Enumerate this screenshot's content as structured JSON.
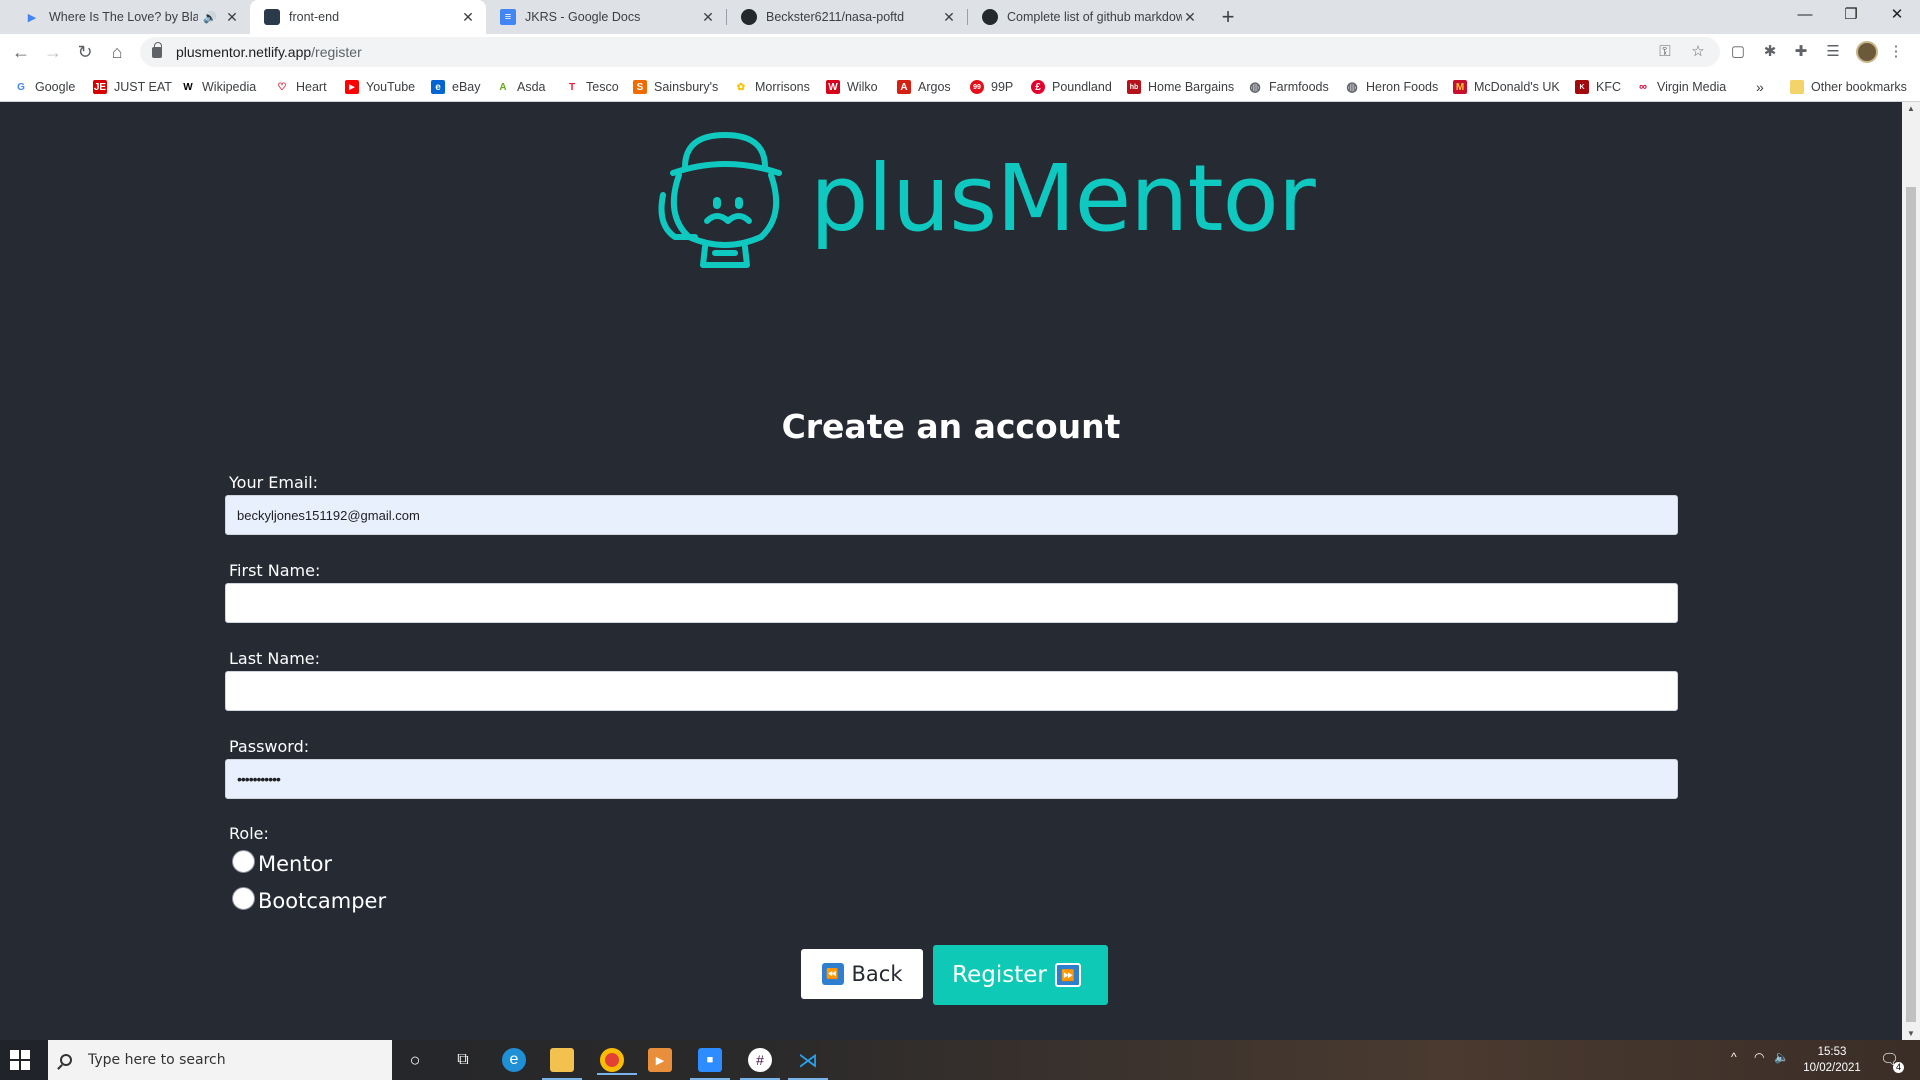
{
  "browser": {
    "tabs": [
      {
        "title": "Where Is The Love? by Black",
        "icon": "play-icon",
        "audio": true
      },
      {
        "title": "front-end",
        "icon": "netlify-icon",
        "active": true
      },
      {
        "title": "JKRS - Google Docs",
        "icon": "docs-icon"
      },
      {
        "title": "Beckster6211/nasa-poftd",
        "icon": "github-icon"
      },
      {
        "title": "Complete list of github markdow",
        "icon": "github-icon"
      }
    ],
    "url": {
      "host": "plusmentor.netlify.app",
      "path": "/register"
    },
    "bookmarks": [
      {
        "label": "Google",
        "icon": "google-icon",
        "color": "#4285f4"
      },
      {
        "label": "JUST EAT",
        "icon": "just-eat-icon",
        "color": "#d50000"
      },
      {
        "label": "Wikipedia",
        "icon": "wikipedia-icon",
        "color": "#000000"
      },
      {
        "label": "Heart",
        "icon": "heart-icon",
        "color": "#d8001b"
      },
      {
        "label": "YouTube",
        "icon": "youtube-icon",
        "color": "#ff0000"
      },
      {
        "label": "eBay",
        "icon": "ebay-icon",
        "color": "#0064d2"
      },
      {
        "label": "Asda",
        "icon": "asda-icon",
        "color": "#68a51c"
      },
      {
        "label": "Tesco",
        "icon": "tesco-icon",
        "color": "#ee1c2e"
      },
      {
        "label": "Sainsbury's",
        "icon": "sainsburys-icon",
        "color": "#f06c00"
      },
      {
        "label": "Morrisons",
        "icon": "morrisons-icon",
        "color": "#f5c300"
      },
      {
        "label": "Wilko",
        "icon": "wilko-icon",
        "color": "#d7001c"
      },
      {
        "label": "Argos",
        "icon": "argos-icon",
        "color": "#d42114"
      },
      {
        "label": "99P",
        "icon": "99p-icon",
        "color": "#e3101b"
      },
      {
        "label": "Poundland",
        "icon": "poundland-icon",
        "color": "#e4002b"
      },
      {
        "label": "Home Bargains",
        "icon": "home-bargains-icon",
        "color": "#b5121b"
      },
      {
        "label": "Farmfoods",
        "icon": "globe-icon",
        "color": "#5f6368"
      },
      {
        "label": "Heron Foods",
        "icon": "globe-icon",
        "color": "#5f6368"
      },
      {
        "label": "McDonald's UK",
        "icon": "mcdonalds-icon",
        "color": "#c8102e"
      },
      {
        "label": "KFC",
        "icon": "kfc-icon",
        "color": "#a3080c"
      },
      {
        "label": "Virgin Media",
        "icon": "virgin-media-icon",
        "color": "#d1002e"
      }
    ],
    "more_bookmarks": "»",
    "other_bookmarks": "Other bookmarks"
  },
  "page": {
    "brand": "plusMentor",
    "heading": "Create an account",
    "brand_color": "#0fc8c0",
    "form": {
      "email": {
        "label": "Your Email:",
        "value": "beckyljones151192@gmail.com"
      },
      "first_name": {
        "label": "First Name:",
        "value": ""
      },
      "last_name": {
        "label": "Last Name:",
        "value": ""
      },
      "password": {
        "label": "Password:",
        "value": "•••••••••••"
      },
      "role": {
        "label": "Role:",
        "options": [
          "Mentor",
          "Bootcamper"
        ]
      }
    },
    "buttons": {
      "back": {
        "label": "Back",
        "emoji": "⏪"
      },
      "register": {
        "label": "Register",
        "emoji": "⏩",
        "color": "#0ec9b5"
      }
    }
  },
  "taskbar": {
    "search_placeholder": "Type here to search",
    "time": "15:53",
    "date": "10/02/2021",
    "notifications": "4"
  }
}
